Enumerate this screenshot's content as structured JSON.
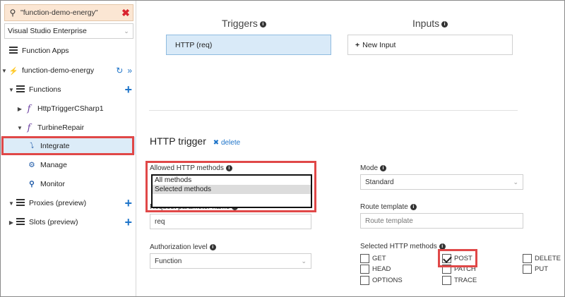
{
  "sidebar": {
    "search_value": "\"function-demo-energy\"",
    "subscription": "Visual Studio Enterprise",
    "function_apps_label": "Function Apps",
    "app_name": "function-demo-energy",
    "functions_label": "Functions",
    "function1": "HttpTriggerCSharp1",
    "function2": "TurbineRepair",
    "integrate_label": "Integrate",
    "manage_label": "Manage",
    "monitor_label": "Monitor",
    "proxies_label": "Proxies (preview)",
    "slots_label": "Slots (preview)"
  },
  "main": {
    "triggers_heading": "Triggers",
    "inputs_heading": "Inputs",
    "trigger_item": "HTTP (req)",
    "new_input": "New Input",
    "section_title": "HTTP trigger",
    "delete_label": "delete",
    "allowed_methods_label": "Allowed HTTP methods",
    "allowed_options": [
      "All methods",
      "Selected methods"
    ],
    "request_param_label": "Request parameter name",
    "request_param_value": "req",
    "auth_level_label": "Authorization level",
    "auth_level_value": "Function",
    "mode_label": "Mode",
    "mode_value": "Standard",
    "route_template_label": "Route template",
    "route_template_placeholder": "Route template",
    "selected_methods_label": "Selected HTTP methods",
    "methods": {
      "get": "GET",
      "head": "HEAD",
      "options": "OPTIONS",
      "post": "POST",
      "patch": "PATCH",
      "trace": "TRACE",
      "delete": "DELETE",
      "put": "PUT"
    },
    "method_checked": {
      "POST": true
    }
  },
  "colors": {
    "accent": "#1e74c9",
    "highlight": "#e04848",
    "selected_bg": "#dcecf8",
    "search_bg": "#fbe6d3"
  }
}
